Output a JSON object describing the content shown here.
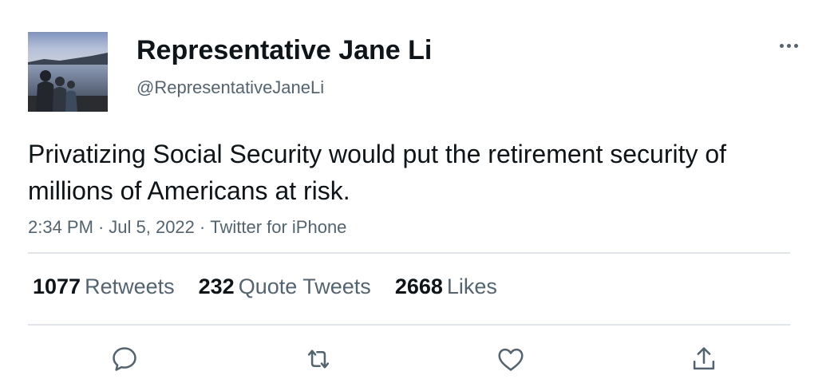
{
  "author": {
    "display_name": "Representative Jane Li",
    "handle": "@RepresentativeJaneLi",
    "avatar_icon": "profile-photo-family-lakeside"
  },
  "tweet": {
    "text": "Privatizing Social Security would put the retirement security of millions of Americans at risk.",
    "time": "2:34 PM",
    "date": "Jul 5, 2022",
    "source": "Twitter for iPhone",
    "separator": "·"
  },
  "stats": {
    "retweets_count": "1077",
    "retweets_label": "Retweets",
    "quotes_count": "232",
    "quotes_label": "Quote Tweets",
    "likes_count": "2668",
    "likes_label": "Likes"
  },
  "actions": {
    "reply_icon": "reply-icon",
    "retweet_icon": "retweet-icon",
    "like_icon": "heart-icon",
    "share_icon": "share-icon",
    "more_icon": "more-horizontal-icon"
  },
  "colors": {
    "text_primary": "#0f1419",
    "text_secondary": "#536471",
    "divider": "#e1e5e9"
  }
}
